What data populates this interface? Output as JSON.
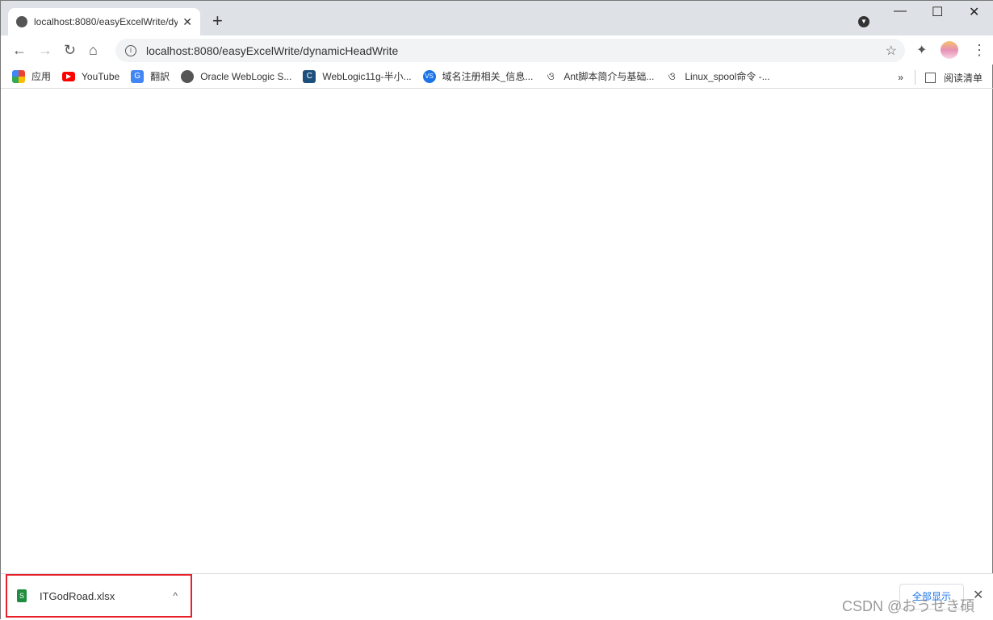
{
  "tab": {
    "title": "localhost:8080/easyExcelWrite/dy",
    "close": "✕",
    "new": "+"
  },
  "window": {
    "minimize": "—",
    "maximize": "☐",
    "close": "✕"
  },
  "toolbar": {
    "url": "localhost:8080/easyExcelWrite/dynamicHeadWrite",
    "back": "←",
    "forward": "→",
    "reload": "↻",
    "home": "⌂",
    "star": "☆",
    "extensions": "✦",
    "menu": "⋮"
  },
  "bookmarks": [
    {
      "label": "应用",
      "icon": "apps-grid-icon",
      "color": "#4285f4"
    },
    {
      "label": "YouTube",
      "icon": "youtube-icon",
      "color": "#ff0000"
    },
    {
      "label": "翻訳",
      "icon": "google-translate-icon",
      "color": "#4285f4"
    },
    {
      "label": "Oracle WebLogic S...",
      "icon": "globe-icon",
      "color": "#555555"
    },
    {
      "label": "WebLogic11g-半小...",
      "icon": "cnblogs-icon",
      "color": "#1c4f7c"
    },
    {
      "label": "域名注册相关_信息...",
      "icon": "vs-icon",
      "color": "#1a73e8"
    },
    {
      "label": "Ant脚本简介与基础...",
      "icon": "bookmark-logo-icon",
      "color": "#ffffff"
    },
    {
      "label": "Linux_spool命令 -...",
      "icon": "bookmark-logo-icon",
      "color": "#ffffff"
    }
  ],
  "bookmarks_more": "»",
  "reading_list": "阅读清单",
  "download": {
    "filename": "ITGodRoad.xlsx",
    "show_all": "全部显示",
    "close": "✕",
    "chevron": "^"
  },
  "watermark": "CSDN @おうせき碩"
}
